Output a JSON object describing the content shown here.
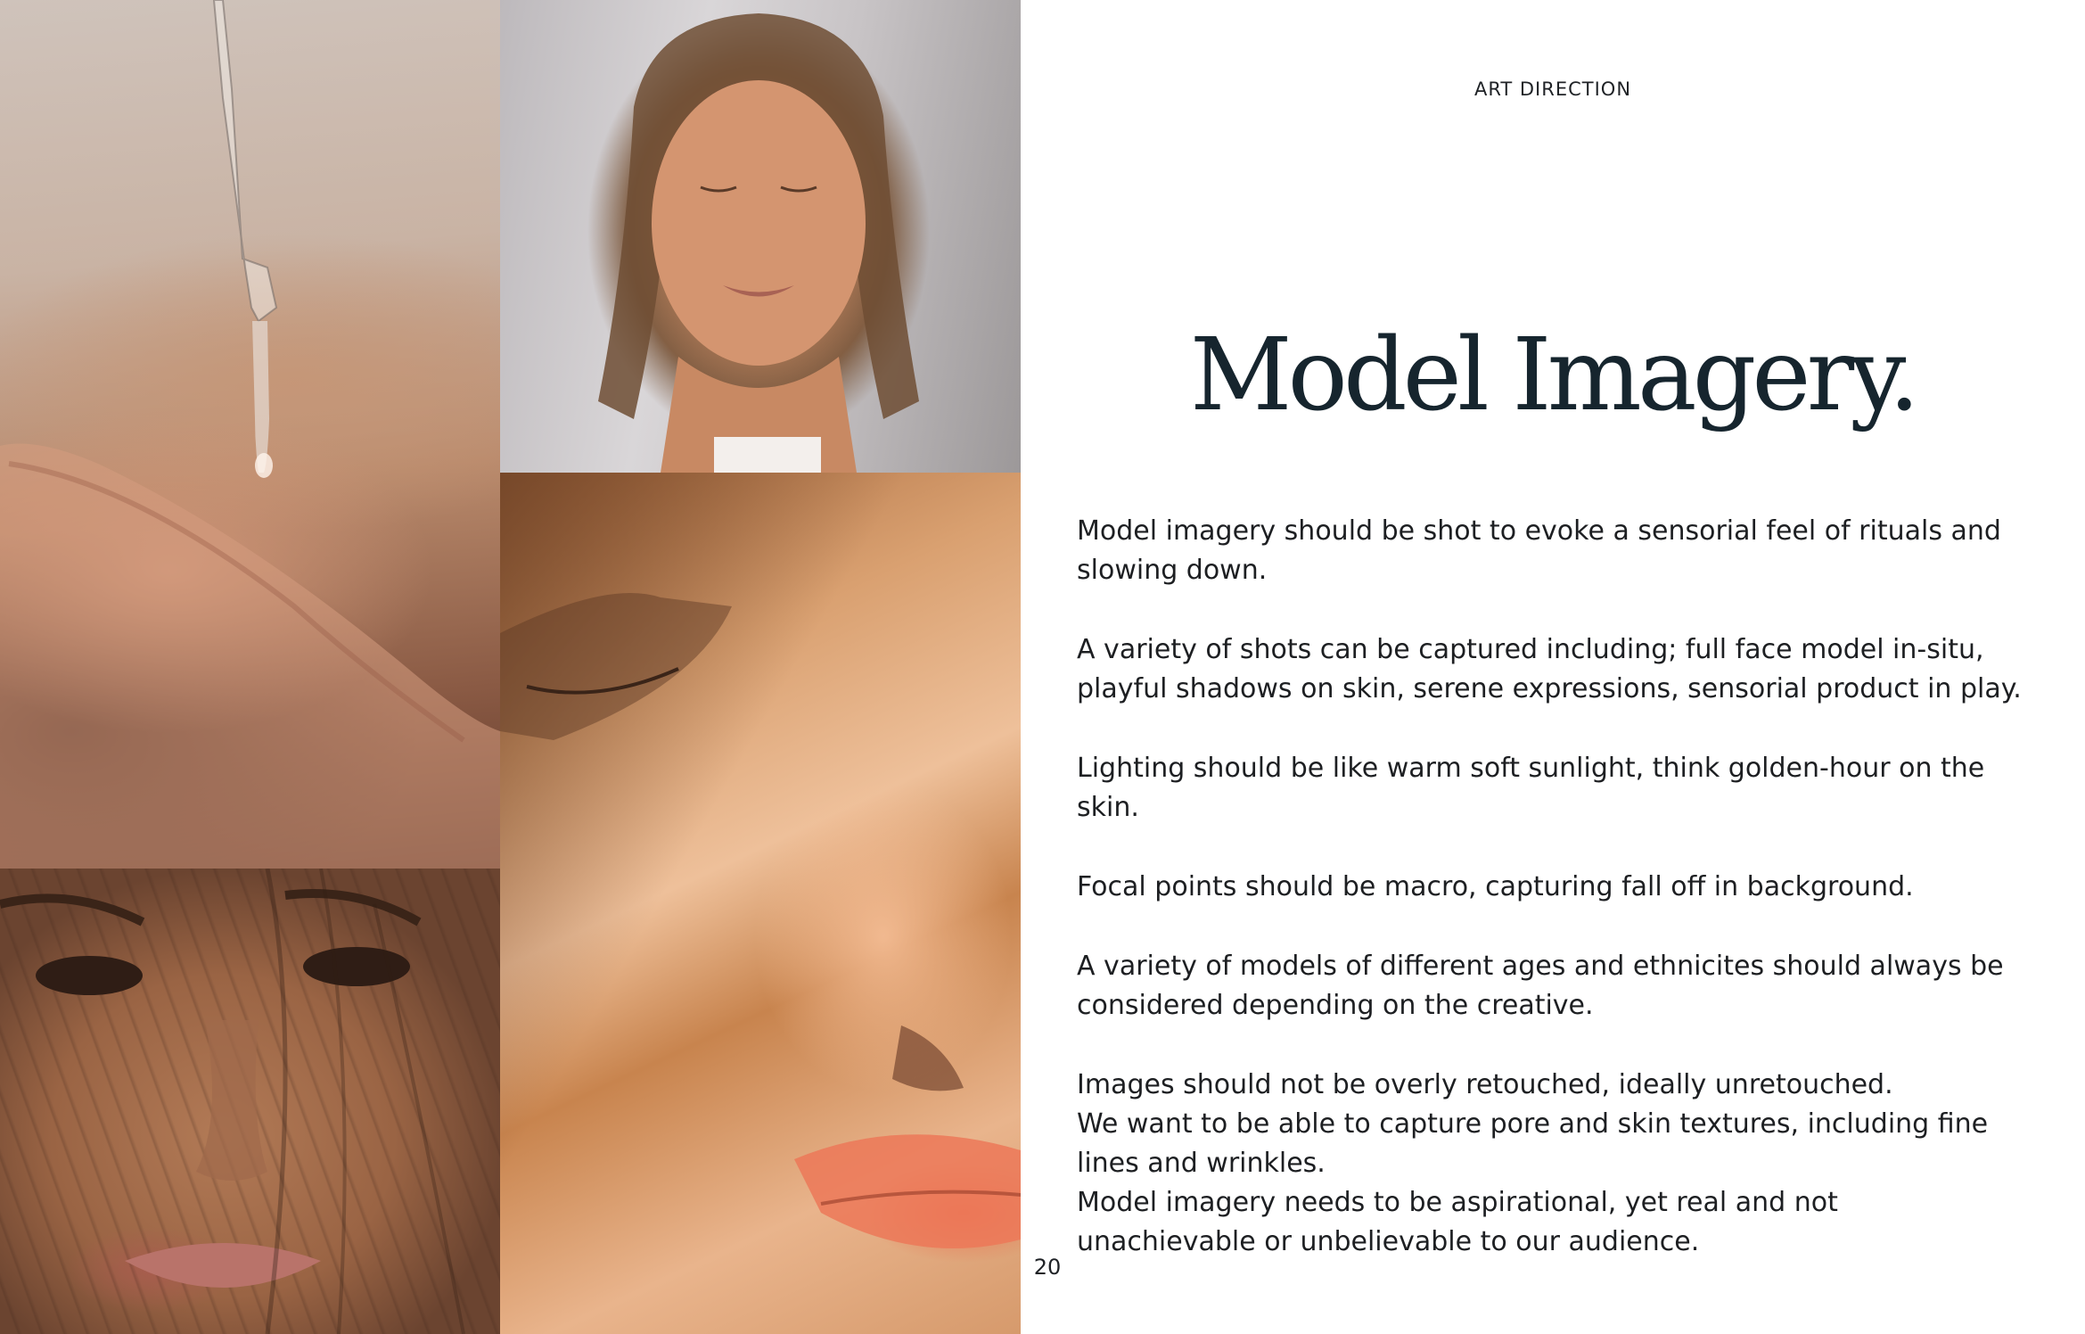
{
  "header": {
    "section_label": "ART DIRECTION"
  },
  "main": {
    "title": "Model Imagery.",
    "paragraphs": [
      "Model imagery should be shot to evoke a sensorial feel of rituals and slowing down.",
      "A variety of shots can be captured including; full face model in-situ, playful shadows on skin, serene expressions, sensorial product in play.",
      "Lighting should be like warm soft sunlight, think golden-hour on the skin.",
      "Focal points should be macro, capturing fall off in background.",
      "A variety of models of different ages and ethnicites should always be considered depending on the creative."
    ],
    "final_lines": [
      "Images should not be overly retouched, ideally unretouched.",
      "We want to be able to capture pore and skin textures, including fine lines and wrinkles.",
      "Model imagery needs to be aspirational, yet real and not unachievable or unbelievable to our audience."
    ]
  },
  "footer": {
    "page_number": "20"
  },
  "images": {
    "dropper": "pipette-dropping-serum-photo",
    "portrait": "woman-eyes-closed-wet-hair-photo",
    "closeup": "sunlit-face-closeup-photo",
    "shadow": "face-with-leaf-shadows-photo"
  }
}
